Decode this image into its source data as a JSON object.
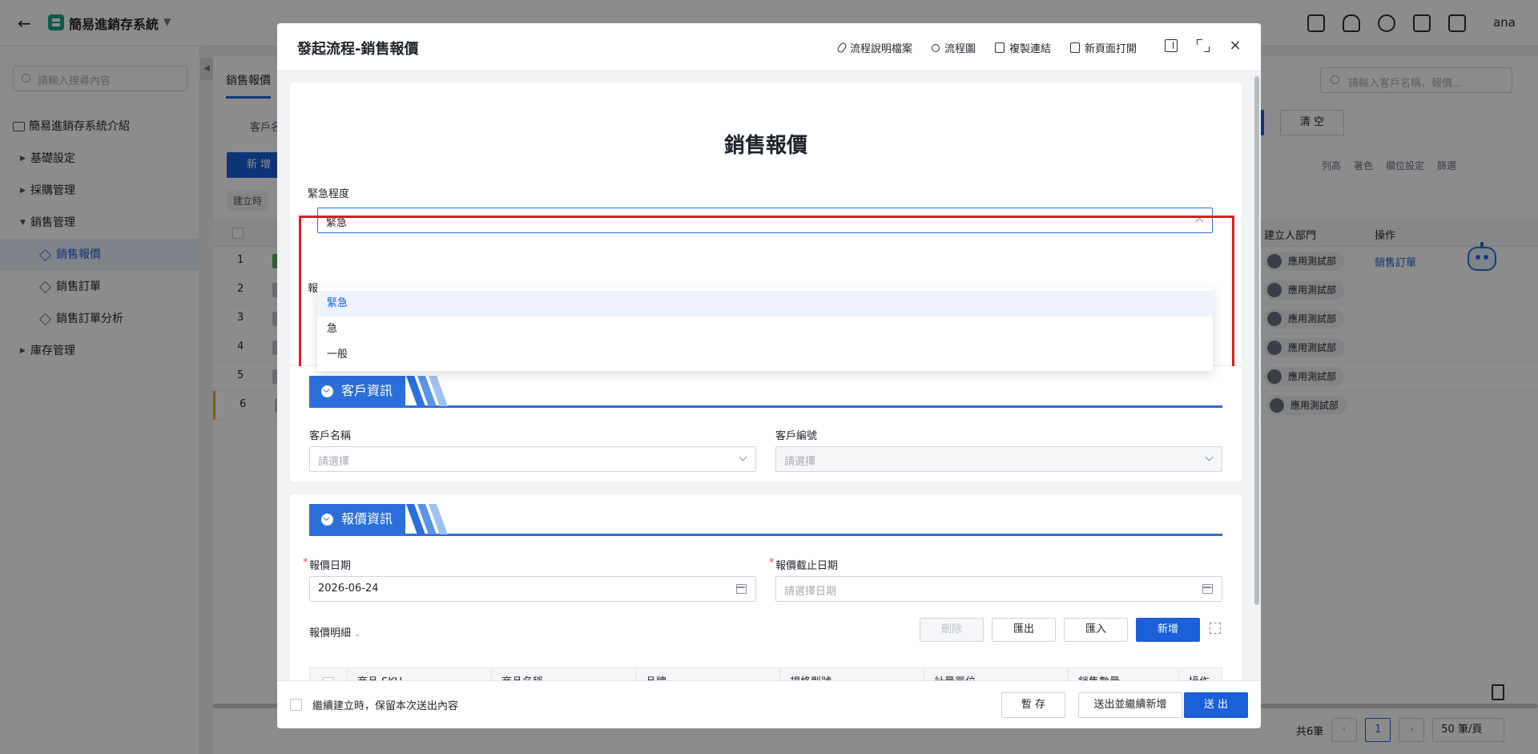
{
  "app": {
    "title": "簡易進銷存系統",
    "user": "ana"
  },
  "sidebar": {
    "search_placeholder": "請輸入搜尋內容",
    "items": [
      {
        "label": "簡易進銷存系統介紹"
      },
      {
        "label": "基礎設定"
      },
      {
        "label": "採購管理"
      },
      {
        "label": "銷售管理"
      },
      {
        "label": "銷售報價"
      },
      {
        "label": "銷售訂單"
      },
      {
        "label": "銷售訂單分析"
      },
      {
        "label": "庫存管理"
      }
    ]
  },
  "main": {
    "tab": "銷售報價",
    "filter_label": "客戶名",
    "add_button": "新 增",
    "sort_chip": "建立時",
    "search_placeholder": "請輸入客戶名稱、報價...",
    "clear_button": "清 空",
    "tools": [
      "列高",
      "著色",
      "欄位設定",
      "篩選"
    ],
    "columns": {
      "dept": "建立人部門",
      "op": "操作"
    },
    "rows": [
      {
        "n": "1",
        "dept": "應用測試部",
        "op": "銷售訂單"
      },
      {
        "n": "2",
        "dept": "應用測試部",
        "op": ""
      },
      {
        "n": "3",
        "dept": "應用測試部",
        "op": ""
      },
      {
        "n": "4",
        "dept": "應用測試部",
        "op": ""
      },
      {
        "n": "5",
        "dept": "應用測試部",
        "op": ""
      },
      {
        "n": "6",
        "dept": "應用測試部",
        "op": ""
      }
    ],
    "pager": {
      "total": "共6筆",
      "page": "1",
      "size": "50 筆/頁"
    }
  },
  "modal": {
    "title": "發起流程-銷售報價",
    "actions": [
      "流程說明檔案",
      "流程圖",
      "複製連結",
      "新頁面打開"
    ],
    "form_title": "銷售報價",
    "urgency": {
      "label": "緊急程度",
      "value": "緊急",
      "options": [
        "緊急",
        "急",
        "一般"
      ],
      "hidden_label_stub": "報"
    },
    "customer_section": {
      "title": "客戶資訊",
      "name_label": "客戶名稱",
      "name_placeholder": "請選擇",
      "code_label": "客戶編號",
      "code_placeholder": "請選擇"
    },
    "quote_section": {
      "title": "報價資訊",
      "date_label": "報價日期",
      "date_value": "2026-06-24",
      "deadline_label": "報價截止日期",
      "deadline_placeholder": "請選擇日期",
      "detail_label": "報價明細",
      "delete_button": "刪除",
      "export_button": "匯出",
      "import_button": "匯入",
      "add_button": "新增",
      "columns": [
        "商品 SKU",
        "商品名稱",
        "品牌",
        "規格型號",
        "計量單位",
        "銷售數量",
        "操作"
      ]
    },
    "footer": {
      "keep_label": "繼續建立時，保留本次送出內容",
      "save_draft": "暫 存",
      "submit_continue": "送出並繼續新增",
      "submit": "送 出"
    }
  }
}
